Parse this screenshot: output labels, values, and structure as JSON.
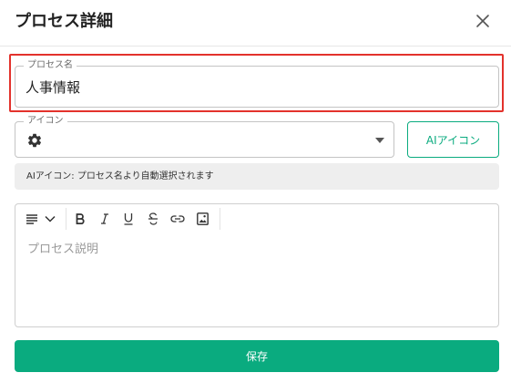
{
  "dialog": {
    "title": "プロセス詳細"
  },
  "process_name": {
    "label": "プロセス名",
    "value": "人事情報"
  },
  "icon_select": {
    "label": "アイコン",
    "selected_icon": "gear-icon"
  },
  "ai_icon_button": {
    "label": "AIアイコン"
  },
  "hint": {
    "text": "AIアイコン: プロセス名より自動選択されます"
  },
  "editor": {
    "toolbar": [
      "paragraph-format-icon",
      "chevron-down-icon",
      "bold-icon",
      "italic-icon",
      "underline-icon",
      "strikethrough-icon",
      "link-icon",
      "image-icon"
    ],
    "placeholder": "プロセス説明"
  },
  "save_button": {
    "label": "保存"
  },
  "colors": {
    "accent": "#0aab7f",
    "highlight": "#e3322c"
  }
}
